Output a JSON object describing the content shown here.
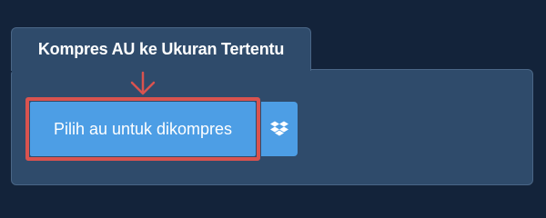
{
  "tab": {
    "title": "Kompres AU ke Ukuran Tertentu"
  },
  "uploader": {
    "choose_label": "Pilih au untuk dikompres",
    "dropbox_icon": "dropbox-icon"
  },
  "colors": {
    "background": "#13233a",
    "panel": "#2f4b6b",
    "button": "#4d9ee5",
    "highlight": "#d9534f"
  }
}
